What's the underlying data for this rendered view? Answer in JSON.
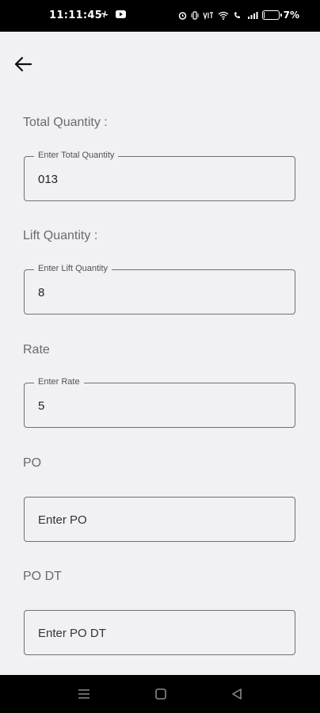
{
  "status_bar": {
    "time": "11:11:45",
    "battery_percent": "7%",
    "battery_level": 0.07
  },
  "form": {
    "total_quantity": {
      "label": "Total Quantity  :",
      "legend": "Enter Total Quantity",
      "value": "013"
    },
    "lift_quantity": {
      "label": "Lift Quantity  :",
      "legend": "Enter Lift Quantity",
      "value": "8"
    },
    "rate": {
      "label": "Rate",
      "legend": "Enter Rate",
      "value": "5"
    },
    "po": {
      "label": "PO",
      "placeholder": "Enter PO"
    },
    "po_dt": {
      "label": "PO DT",
      "placeholder": "Enter PO DT"
    }
  }
}
